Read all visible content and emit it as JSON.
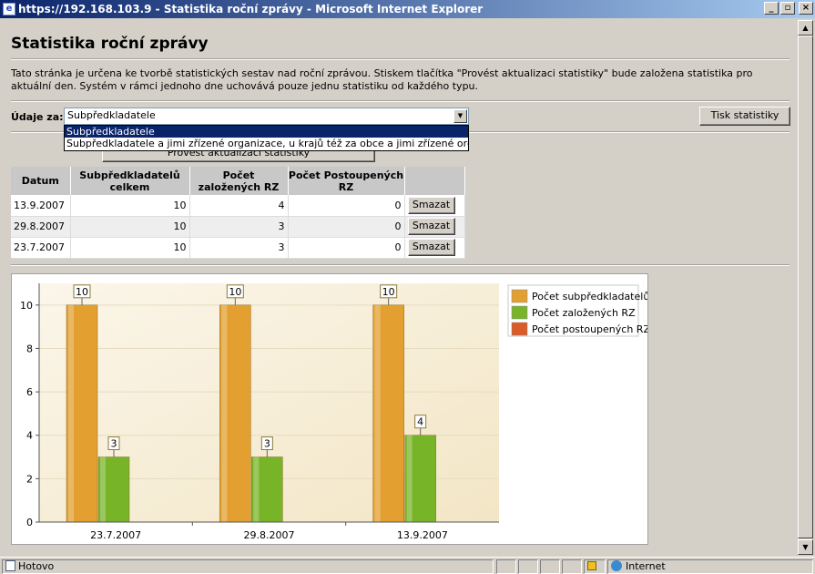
{
  "window": {
    "title": "https://192.168.103.9 - Statistika roční zprávy - Microsoft Internet Explorer"
  },
  "page": {
    "heading": "Statistika roční zprávy",
    "description": "Tato stránka je určena ke tvorbě statistických sestav nad roční zprávou. Stiskem tlačítka \"Provést aktualizaci statistiky\" bude založena statistika pro aktuální den. Systém v rámci jednoho dne uchovává pouze jednu statistiku od každého typu.",
    "udaje_label": "Údaje za:",
    "select_value": "Subpředkladatele",
    "dropdown_options": [
      "Subpředkladatele",
      "Subpředkladatele a jimi zřízené organizace, u krajů též za obce a jimi zřízené organizace"
    ],
    "tisk_button": "Tisk statistiky",
    "provest_button": "Provést aktualizaci statistiky"
  },
  "table": {
    "headers": [
      "Datum",
      "Subpředkladatelů celkem",
      "Počet založených RZ",
      "Počet Postoupených RZ",
      ""
    ],
    "rows": [
      {
        "datum": "13.9.2007",
        "celkem": "10",
        "zalozenych": "4",
        "postoupenych": "0",
        "action": "Smazat"
      },
      {
        "datum": "29.8.2007",
        "celkem": "10",
        "zalozenych": "3",
        "postoupenych": "0",
        "action": "Smazat"
      },
      {
        "datum": "23.7.2007",
        "celkem": "10",
        "zalozenych": "3",
        "postoupenych": "0",
        "action": "Smazat"
      }
    ]
  },
  "chart_data": {
    "type": "bar",
    "categories": [
      "23.7.2007",
      "29.8.2007",
      "13.9.2007"
    ],
    "series": [
      {
        "name": "Počet subpředkladatelů",
        "values": [
          10,
          10,
          10
        ],
        "color": "#e3a030"
      },
      {
        "name": "Počet založených RZ",
        "values": [
          3,
          3,
          4
        ],
        "color": "#78b428"
      },
      {
        "name": "Počet postoupených RZ",
        "values": [
          0,
          0,
          0
        ],
        "color": "#dc5a28"
      }
    ],
    "ylim": [
      0,
      11
    ],
    "yticks": [
      0,
      2,
      4,
      6,
      8,
      10
    ],
    "legend": "top-right",
    "grid": true
  },
  "statusbar": {
    "status": "Hotovo",
    "zone": "Internet"
  }
}
